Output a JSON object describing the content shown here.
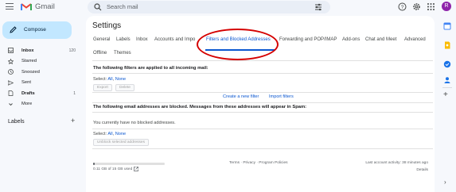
{
  "app": {
    "brand": "Gmail"
  },
  "search": {
    "placeholder": "Search mail"
  },
  "header": {
    "avatar_letter": "R"
  },
  "compose": {
    "label": "Compose"
  },
  "nav": [
    {
      "label": "Inbox",
      "count": "120",
      "icon": "inbox-icon",
      "bold": true
    },
    {
      "label": "Starred",
      "count": "",
      "icon": "star-icon",
      "bold": false
    },
    {
      "label": "Snoozed",
      "count": "",
      "icon": "clock-icon",
      "bold": false
    },
    {
      "label": "Sent",
      "count": "",
      "icon": "send-icon",
      "bold": false
    },
    {
      "label": "Drafts",
      "count": "1",
      "icon": "draft-icon",
      "bold": true
    },
    {
      "label": "More",
      "count": "",
      "icon": "chevron-down-icon",
      "bold": false
    }
  ],
  "labels": {
    "heading": "Labels"
  },
  "settings": {
    "title": "Settings",
    "tabs": [
      "General",
      "Labels",
      "Inbox",
      "Accounts and Impo",
      "Filters and Blocked Addresses",
      "Forwarding and POP/IMAP",
      "Add-ons",
      "Chat and Meet",
      "Advanced",
      "Offline",
      "Themes"
    ],
    "active_tab": "Filters and Blocked Addresses"
  },
  "filters": {
    "heading": "The following filters are applied to all incoming mail:",
    "select_label": "Select:",
    "select_all": "All",
    "select_none": "None",
    "export_label": "Export",
    "delete_label": "Delete",
    "create_filter": "Create a new filter",
    "import_filters": "Import filters"
  },
  "blocked": {
    "heading": "The following email addresses are blocked. Messages from these addresses will appear in Spam:",
    "empty_message": "You currently have no blocked addresses.",
    "select_label": "Select:",
    "select_all": "All",
    "select_none": "None",
    "unblock_label": "Unblock selected addresses"
  },
  "footer": {
    "storage": "0.11 GB of 15 GB used",
    "storage_fraction": 0.01,
    "links": "Terms · Privacy · Program Policies",
    "last_activity": "Last account activity: 38 minutes ago",
    "details": "Details"
  },
  "colors": {
    "accent": "#0b57d0",
    "compose_bg": "#c2e7ff",
    "highlight": "#d50000",
    "avatar": "#8e24aa"
  }
}
